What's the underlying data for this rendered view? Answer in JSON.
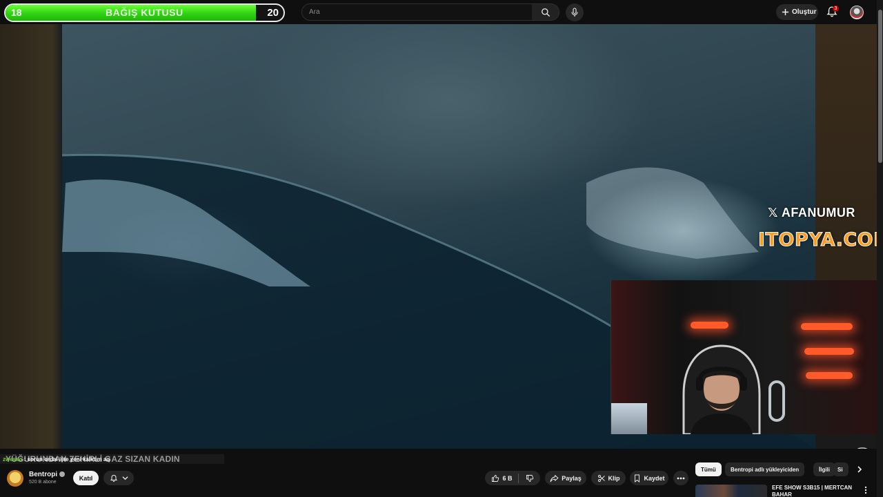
{
  "donation": {
    "start": "18",
    "title": "BAĞIŞ KUTUSU",
    "goal": "20",
    "progress": 0.9
  },
  "search": {
    "placeholder": "Ara"
  },
  "header": {
    "create_label": "Oluştur",
    "notification_count": "3"
  },
  "overlay": {
    "x_handle": "AFANUMUR",
    "sponsor": "ITOPYA.COM"
  },
  "video": {
    "title": "YÜĞURUNDAN ZEHİRLİ GAZ SIZAN KADIN"
  },
  "chat": {
    "user": "zwesso",
    "message": "sorun ordai işte yeni kalktım aq"
  },
  "channel": {
    "name": "Bentropi",
    "subscribers": "520 B abone",
    "join_label": "Katıl"
  },
  "actions": {
    "likes": "6 B",
    "share": "Paylaş",
    "clip": "Klip",
    "save": "Kaydet"
  },
  "chips": [
    "Tümü",
    "Bentropi adlı yükleyiciden",
    "İlgili",
    "Si"
  ],
  "recommended": {
    "title": "EFE SHOW S3B15 | MERTCAN BAHAR"
  },
  "colors": {
    "donation_fill": "#2fd312",
    "sponsor": "#ff9a1e",
    "background": "#0f0f0f"
  }
}
